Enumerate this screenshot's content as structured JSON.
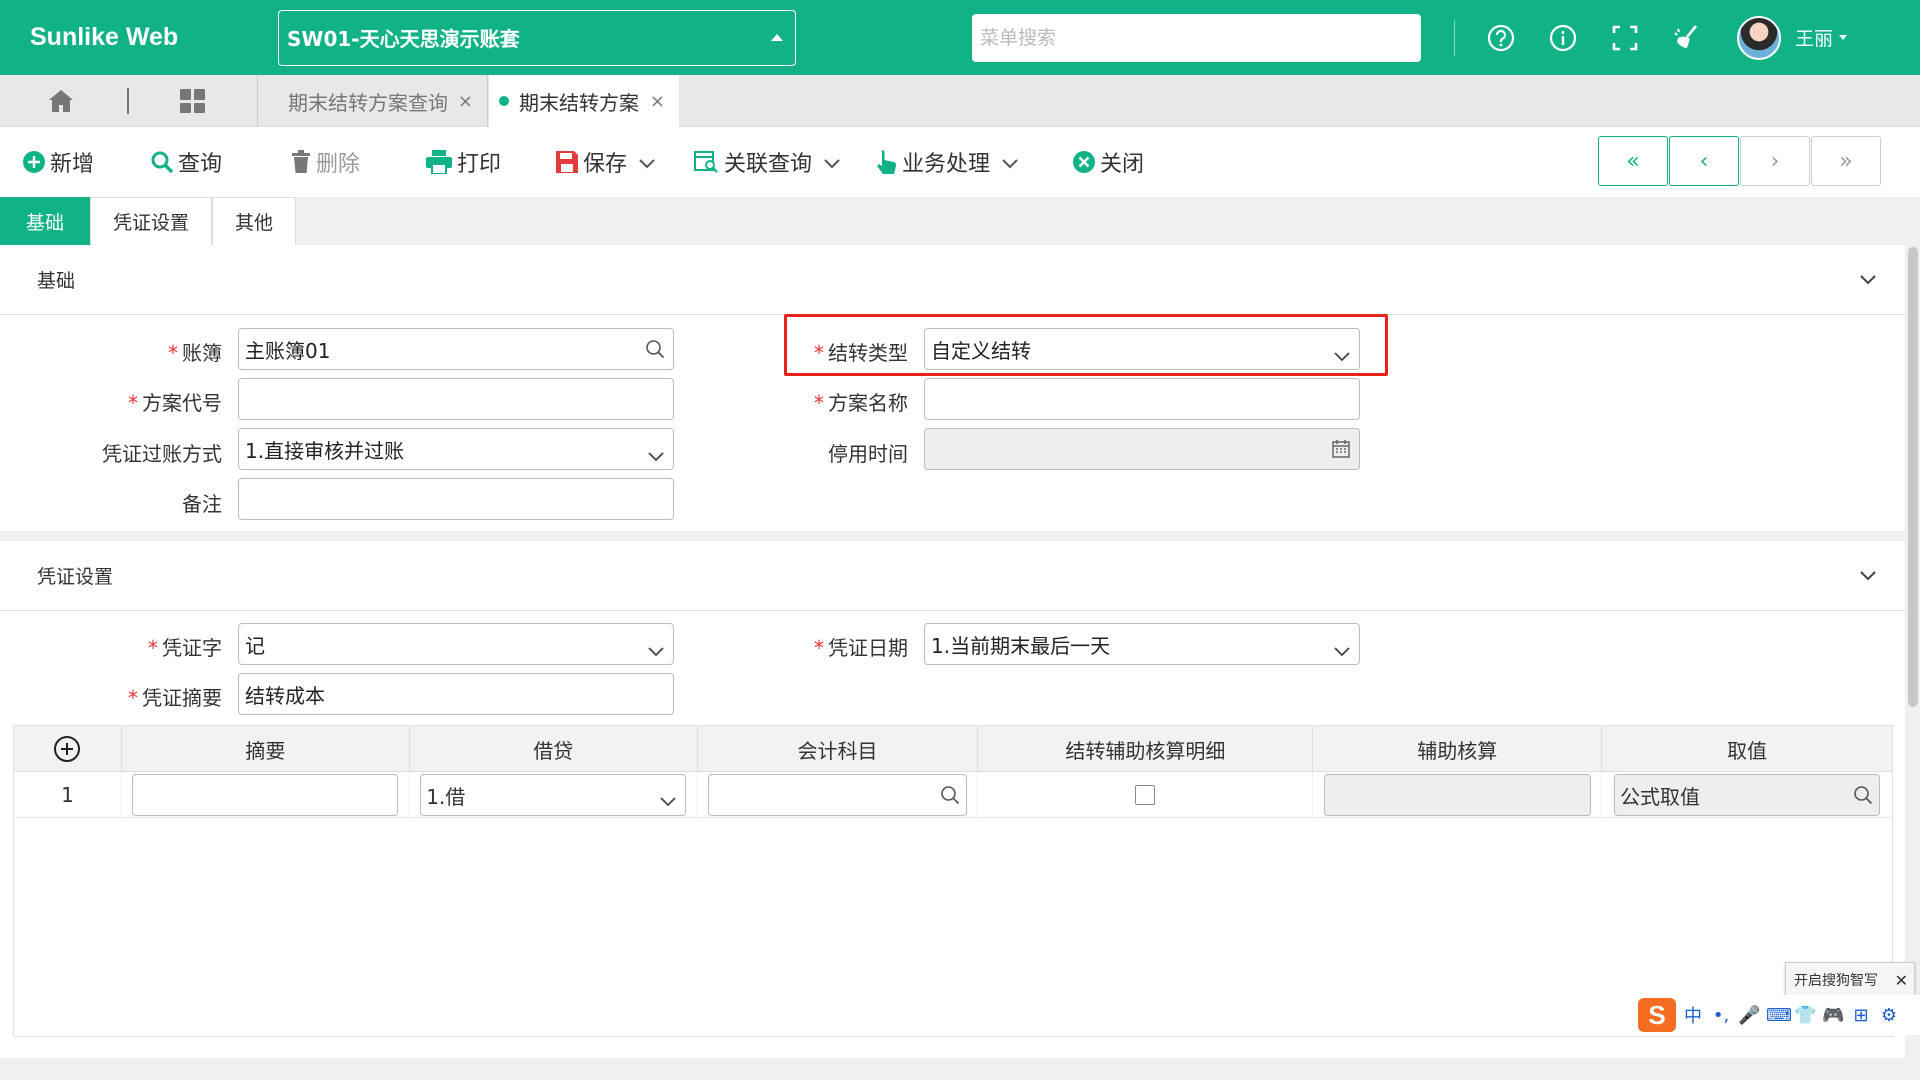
{
  "header": {
    "brand": "Sunlike Web",
    "account": "SW01-天心天思演示账套",
    "search_placeholder": "菜单搜索",
    "user_name": "王丽",
    "icons": [
      "help-icon",
      "info-icon",
      "fullscreen-icon",
      "clean-icon"
    ]
  },
  "tabs": {
    "items": [
      {
        "label": "期末结转方案查询",
        "active": false
      },
      {
        "label": "期末结转方案",
        "active": true
      }
    ],
    "close_glyph": "×"
  },
  "toolbar": {
    "new": "新增",
    "query": "查询",
    "delete": "删除",
    "print": "打印",
    "save": "保存",
    "related_query": "关联查询",
    "business": "业务处理",
    "close": "关闭",
    "nav": [
      "«",
      "‹",
      "›",
      "»"
    ]
  },
  "subtabs": [
    "基础",
    "凭证设置",
    "其他"
  ],
  "basic_section": {
    "title": "基础",
    "fields": {
      "ledger": {
        "label": "账簿",
        "value": "主账簿01",
        "required": true
      },
      "transfer_type": {
        "label": "结转类型",
        "value": "自定义结转",
        "required": true
      },
      "scheme_code": {
        "label": "方案代号",
        "value": "",
        "required": true
      },
      "scheme_name": {
        "label": "方案名称",
        "value": "",
        "required": true
      },
      "posting_mode": {
        "label": "凭证过账方式",
        "value": "1.直接审核并过账",
        "required": false
      },
      "disable_time": {
        "label": "停用时间",
        "value": "",
        "required": false
      },
      "remark": {
        "label": "备注",
        "value": "",
        "required": false
      }
    }
  },
  "voucher_section": {
    "title": "凭证设置",
    "fields": {
      "voucher_word": {
        "label": "凭证字",
        "value": "记",
        "required": true
      },
      "voucher_date": {
        "label": "凭证日期",
        "value": "1.当前期末最后一天",
        "required": true
      },
      "voucher_summary": {
        "label": "凭证摘要",
        "value": "结转成本",
        "required": true
      }
    }
  },
  "grid": {
    "columns": [
      "摘要",
      "借贷",
      "会计科目",
      "结转辅助核算明细",
      "辅助核算",
      "取值"
    ],
    "rows": [
      {
        "index": "1",
        "summary": "",
        "debit_credit": "1.借",
        "account": "",
        "aux_detail_checked": false,
        "aux": "",
        "value": "公式取值"
      }
    ]
  },
  "ime": {
    "tip": "开启搜狗智写",
    "logo": "S",
    "items": [
      "中",
      "•,",
      "🎤",
      "⌨",
      "👕",
      "🎮",
      "⊞",
      "⚙"
    ]
  },
  "colors": {
    "brand_green": "#11b386",
    "required_red": "#e33333",
    "highlight_red": "#e8221a"
  }
}
